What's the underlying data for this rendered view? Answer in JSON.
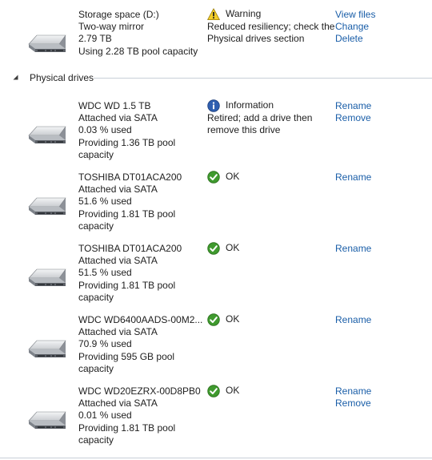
{
  "storage_space": {
    "name": "Storage space (D:)",
    "resiliency": "Two-way mirror",
    "size": "2.79 TB",
    "usage": "Using 2.28 TB pool capacity",
    "status_title": "Warning",
    "status_detail_1": "Reduced resiliency; check the",
    "status_detail_2": "Physical drives section",
    "actions": {
      "view_files": "View files",
      "change": "Change",
      "delete": "Delete"
    }
  },
  "physical_drives": {
    "section_title": "Physical drives",
    "drives": [
      {
        "name": "WDC WD 1.5 TB",
        "connection": "Attached via SATA",
        "used": "0.03 % used",
        "providing_1": "Providing 1.36 TB pool",
        "providing_2": "capacity",
        "status_title": "Information",
        "status_detail_1": "Retired; add a drive then",
        "status_detail_2": "remove this drive",
        "status_icon": "info-icon",
        "actions": {
          "rename": "Rename",
          "remove": "Remove"
        }
      },
      {
        "name": "TOSHIBA DT01ACA200",
        "connection": "Attached via SATA",
        "used": "51.6 % used",
        "providing_1": "Providing 1.81 TB pool",
        "providing_2": "capacity",
        "status_title": "OK",
        "status_icon": "ok-check-icon",
        "actions": {
          "rename": "Rename"
        }
      },
      {
        "name": "TOSHIBA DT01ACA200",
        "connection": "Attached via SATA",
        "used": "51.5 % used",
        "providing_1": "Providing 1.81 TB pool",
        "providing_2": "capacity",
        "status_title": "OK",
        "status_icon": "ok-check-icon",
        "actions": {
          "rename": "Rename"
        }
      },
      {
        "name": "WDC WD6400AADS-00M2...",
        "connection": "Attached via SATA",
        "used": "70.9 % used",
        "providing_1": "Providing 595 GB pool",
        "providing_2": "capacity",
        "status_title": "OK",
        "status_icon": "ok-check-icon",
        "actions": {
          "rename": "Rename"
        }
      },
      {
        "name": "WDC WD20EZRX-00D8PB0",
        "connection": "Attached via SATA",
        "used": "0.01 % used",
        "providing_1": "Providing 1.81 TB pool",
        "providing_2": "capacity",
        "status_title": "OK",
        "status_icon": "ok-check-icon",
        "actions": {
          "rename": "Rename",
          "remove": "Remove"
        }
      }
    ]
  },
  "colors": {
    "link": "#1a5ea8",
    "text": "#1e1e1e",
    "warning_yellow": "#f4cf2a",
    "info_blue": "#2f5fb0",
    "ok_green": "#3f9a2e",
    "rule": "#c8cfd8"
  }
}
